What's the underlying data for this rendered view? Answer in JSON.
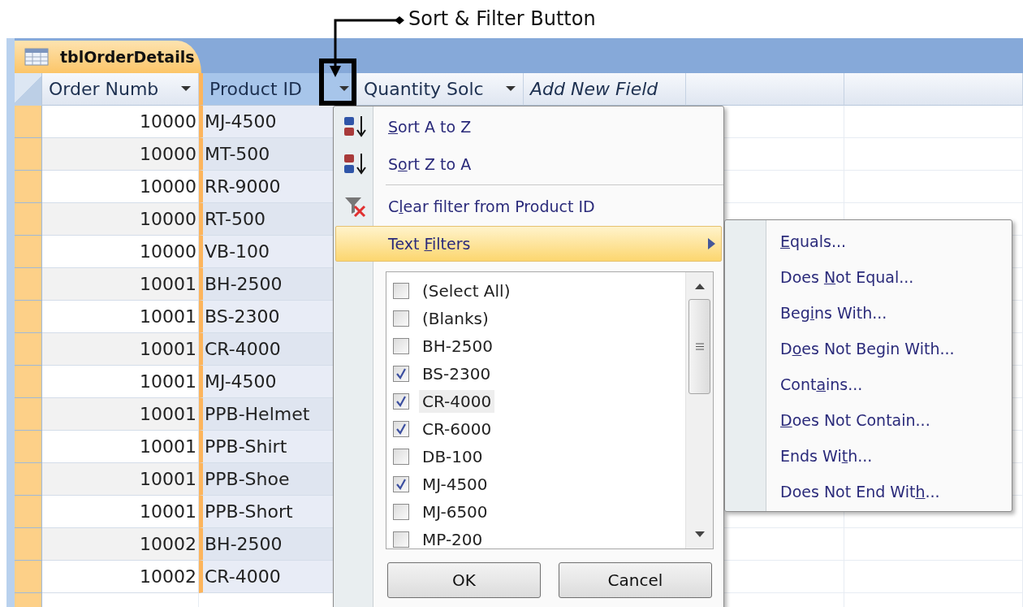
{
  "annotation": {
    "label": "Sort & Filter Button"
  },
  "tab": {
    "title": "tblOrderDetails",
    "selected": true
  },
  "columns": [
    {
      "label": "Order Numb",
      "selected": false,
      "kind": "field"
    },
    {
      "label": "Product ID",
      "selected": true,
      "kind": "field"
    },
    {
      "label": "Quantity Solc",
      "selected": false,
      "kind": "field"
    },
    {
      "label": "Add New Field",
      "selected": false,
      "kind": "new"
    }
  ],
  "rows": [
    {
      "order": "10000",
      "product": "MJ-4500"
    },
    {
      "order": "10000",
      "product": "MT-500"
    },
    {
      "order": "10000",
      "product": "RR-9000"
    },
    {
      "order": "10000",
      "product": "RT-500"
    },
    {
      "order": "10000",
      "product": "VB-100"
    },
    {
      "order": "10001",
      "product": "BH-2500"
    },
    {
      "order": "10001",
      "product": "BS-2300"
    },
    {
      "order": "10001",
      "product": "CR-4000"
    },
    {
      "order": "10001",
      "product": "MJ-4500"
    },
    {
      "order": "10001",
      "product": "PPB-Helmet"
    },
    {
      "order": "10001",
      "product": "PPB-Shirt"
    },
    {
      "order": "10001",
      "product": "PPB-Shoe"
    },
    {
      "order": "10001",
      "product": "PPB-Short"
    },
    {
      "order": "10002",
      "product": "BH-2500"
    },
    {
      "order": "10002",
      "product": "CR-4000"
    }
  ],
  "filter_menu": {
    "items": [
      {
        "kind": "sort_az",
        "key": "S",
        "post": "ort A to Z",
        "selected": false
      },
      {
        "kind": "sort_za",
        "pre": "S",
        "key": "o",
        "post": "rt Z to A",
        "selected": false
      },
      {
        "kind": "separator"
      },
      {
        "kind": "clear",
        "pre": "C",
        "key": "l",
        "post": "ear filter from Product ID",
        "selected": false
      },
      {
        "kind": "submenu",
        "pre": "Text ",
        "key": "F",
        "post": "ilters",
        "selected": true
      }
    ],
    "values": [
      {
        "label": "(Select All)",
        "checked": false,
        "highlighted": false
      },
      {
        "label": "(Blanks)",
        "checked": false,
        "highlighted": false
      },
      {
        "label": "BH-2500",
        "checked": false,
        "highlighted": false
      },
      {
        "label": "BS-2300",
        "checked": true,
        "highlighted": false
      },
      {
        "label": "CR-4000",
        "checked": true,
        "highlighted": true
      },
      {
        "label": "CR-6000",
        "checked": true,
        "highlighted": false
      },
      {
        "label": "DB-100",
        "checked": false,
        "highlighted": false
      },
      {
        "label": "MJ-4500",
        "checked": true,
        "highlighted": false
      },
      {
        "label": "MJ-6500",
        "checked": false,
        "highlighted": false
      },
      {
        "label": "MP-200",
        "checked": false,
        "highlighted": false
      }
    ],
    "buttons": [
      "OK",
      "Cancel"
    ]
  },
  "text_filters": {
    "items": [
      {
        "key": "E",
        "post": "quals..."
      },
      {
        "pre": "Does ",
        "key": "N",
        "post": "ot Equal..."
      },
      {
        "pre": "Beg",
        "key": "i",
        "post": "ns With..."
      },
      {
        "pre": "D",
        "key": "o",
        "post": "es Not Begin With..."
      },
      {
        "pre": "Cont",
        "key": "a",
        "post": "ins..."
      },
      {
        "key": "D",
        "post": "oes Not Contain..."
      },
      {
        "pre": "Ends Wi",
        "key": "t",
        "post": "h..."
      },
      {
        "pre": "Does Not End Wit",
        "key": "h",
        "post": "..."
      }
    ]
  }
}
